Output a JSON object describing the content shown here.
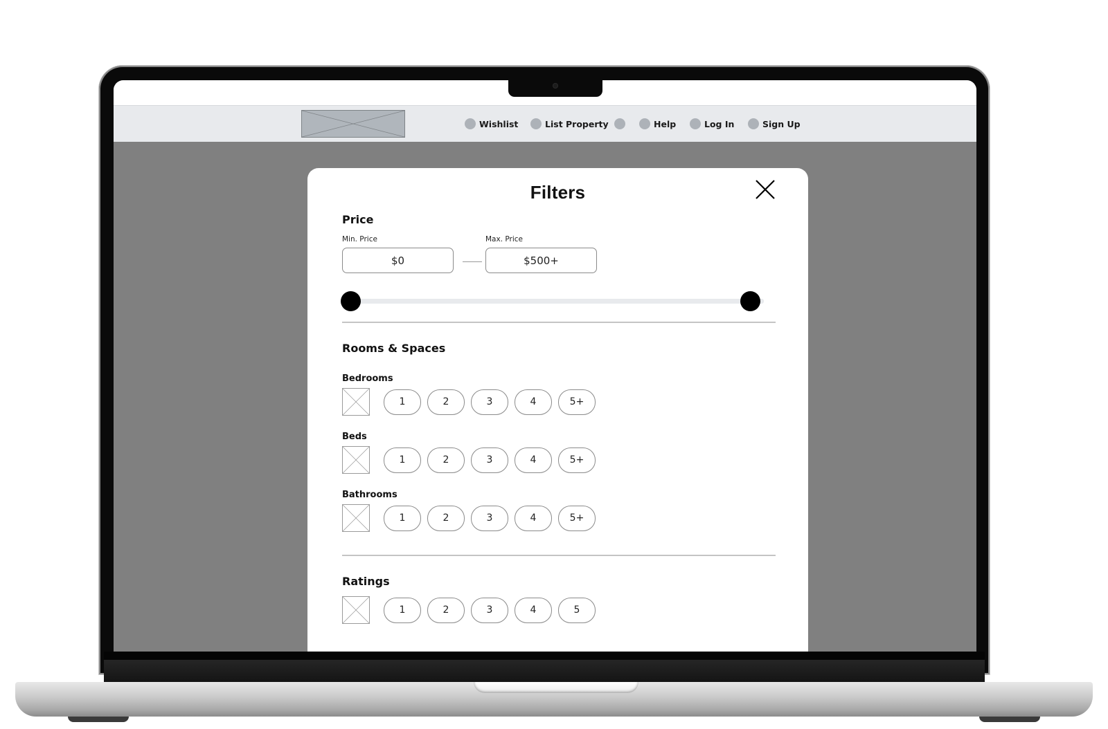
{
  "nav": {
    "logo": "logo-placeholder",
    "items": [
      {
        "icon": "circle-icon",
        "label": "Wishlist"
      },
      {
        "icon": "circle-icon",
        "label": "List Property"
      },
      {
        "icon": "circle-icon",
        "label": ""
      },
      {
        "icon": "circle-icon",
        "label": "Help"
      },
      {
        "icon": "circle-icon",
        "label": "Log In"
      },
      {
        "icon": "circle-icon",
        "label": "Sign Up"
      }
    ]
  },
  "modal": {
    "title": "Filters",
    "close_icon": "close-icon",
    "price": {
      "title": "Price",
      "min_label": "Min. Price",
      "min_value": "$0",
      "max_label": "Max. Price",
      "max_value": "$500+",
      "slider": {
        "min_fraction": 0.0,
        "max_fraction": 1.0
      }
    },
    "rooms": {
      "title": "Rooms & Spaces",
      "groups": [
        {
          "label": "Bedrooms",
          "options": [
            "1",
            "2",
            "3",
            "4",
            "5+"
          ]
        },
        {
          "label": "Beds",
          "options": [
            "1",
            "2",
            "3",
            "4",
            "5+"
          ]
        },
        {
          "label": "Bathrooms",
          "options": [
            "1",
            "2",
            "3",
            "4",
            "5+"
          ]
        }
      ]
    },
    "ratings": {
      "title": "Ratings",
      "options": [
        "1",
        "2",
        "3",
        "4",
        "5"
      ]
    }
  },
  "colors": {
    "overlay": "#808080",
    "navbar": "#e8eaed",
    "nav_dot": "#adb2b8",
    "slider_thumb": "#000000",
    "slider_track": "#e8eaed"
  }
}
